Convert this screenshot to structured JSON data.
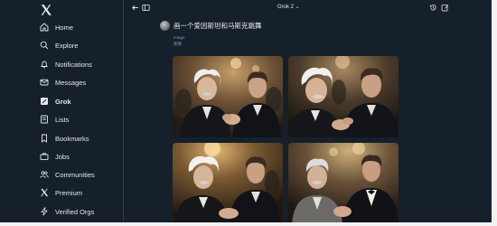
{
  "sidebar": {
    "logo": "x-logo-icon",
    "items": [
      {
        "label": "Home",
        "icon": "home-icon"
      },
      {
        "label": "Explore",
        "icon": "search-icon"
      },
      {
        "label": "Notifications",
        "icon": "bell-icon"
      },
      {
        "label": "Messages",
        "icon": "envelope-icon"
      },
      {
        "label": "Grok",
        "icon": "grok-icon",
        "active": true
      },
      {
        "label": "Lists",
        "icon": "list-icon"
      },
      {
        "label": "Bookmarks",
        "icon": "bookmark-icon"
      },
      {
        "label": "Jobs",
        "icon": "briefcase-icon"
      },
      {
        "label": "Communities",
        "icon": "people-icon"
      },
      {
        "label": "Premium",
        "icon": "x-logo-icon"
      },
      {
        "label": "Verified Orgs",
        "icon": "lightning-icon"
      }
    ]
  },
  "header": {
    "model_label": "Grok 2 ⌄",
    "icons": [
      "back-arrow-icon",
      "sidebar-toggle-icon",
      "history-icon",
      "new-chat-icon"
    ]
  },
  "chat": {
    "prompt": "画一个爱因斯坦和马斯克跳舞",
    "meta_type": "Image",
    "meta_sub": "图像",
    "images": [
      {
        "description": "einstein-and-musk-handshake-1"
      },
      {
        "description": "einstein-and-musk-conversation-2"
      },
      {
        "description": "einstein-and-musk-handshake-3"
      },
      {
        "description": "einstein-and-musk-handshake-4"
      }
    ]
  },
  "colors": {
    "background": "#15202b",
    "text": "#e7e9ea",
    "muted": "#8b98a5",
    "divider": "#2f3b47"
  }
}
